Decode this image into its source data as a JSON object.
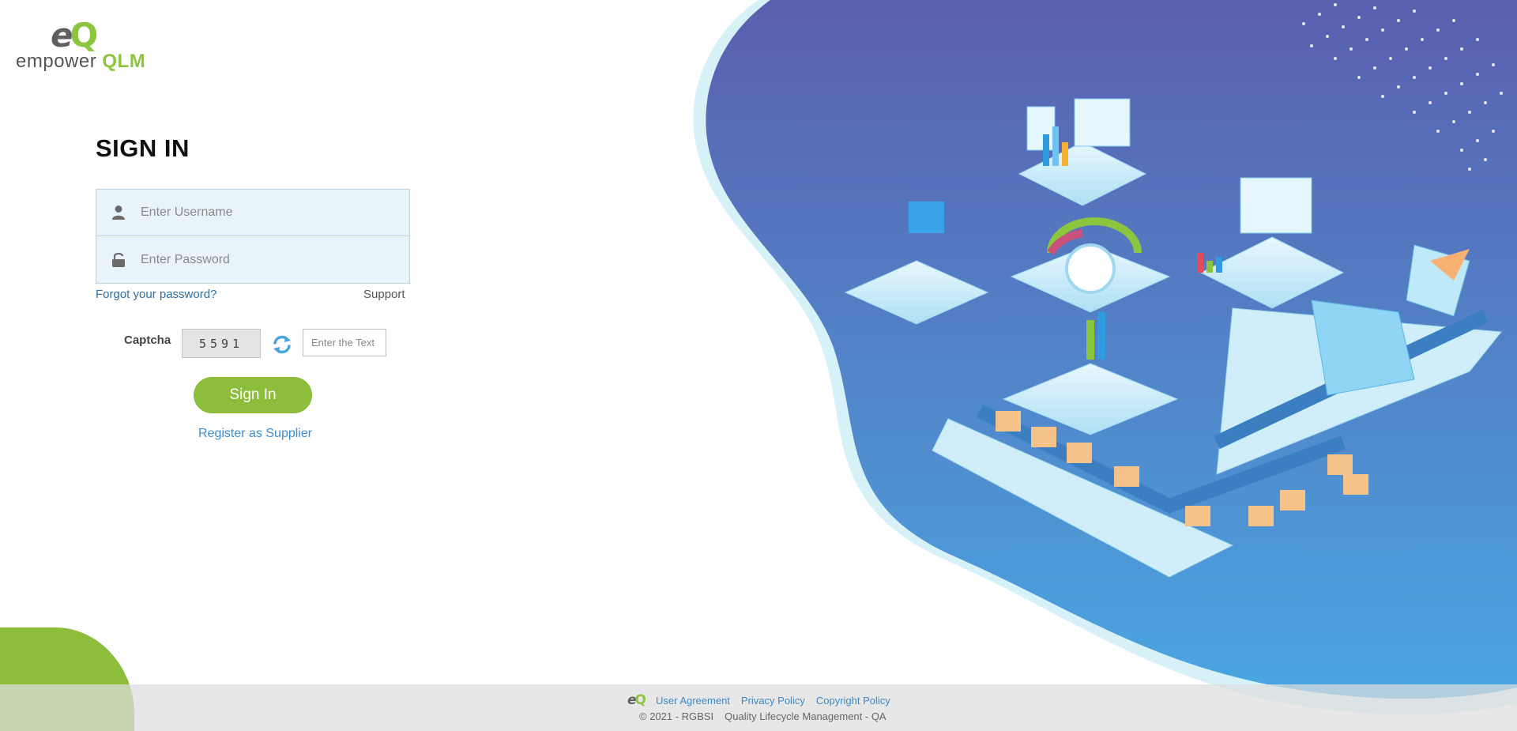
{
  "colors": {
    "brand_green": "#8cbd3b",
    "link_blue": "#3a8dd6",
    "panel_blue_top": "#5a5fae",
    "panel_blue_bottom": "#4aa6e0"
  },
  "logo": {
    "mark_e": "e",
    "mark_q": "Q",
    "word": "empower",
    "product": "QLM"
  },
  "signin": {
    "title": "SIGN IN",
    "username_placeholder": "Enter Username",
    "password_placeholder": "Enter Password",
    "forgot_label": "Forgot your password?",
    "support_label": "Support",
    "captcha_label": "Captcha",
    "captcha_code": "5591",
    "captcha_placeholder": "Enter the Text",
    "button_label": "Sign In",
    "register_label": "Register as Supplier"
  },
  "footer": {
    "links": [
      "User Agreement",
      "Privacy Policy",
      "Copyright Policy"
    ],
    "copyright": "© 2021 - RGBSI",
    "product_name": "Quality Lifecycle Management - QA"
  },
  "icons": {
    "username": "user-icon",
    "password": "lock-icon",
    "refresh": "refresh-icon"
  }
}
